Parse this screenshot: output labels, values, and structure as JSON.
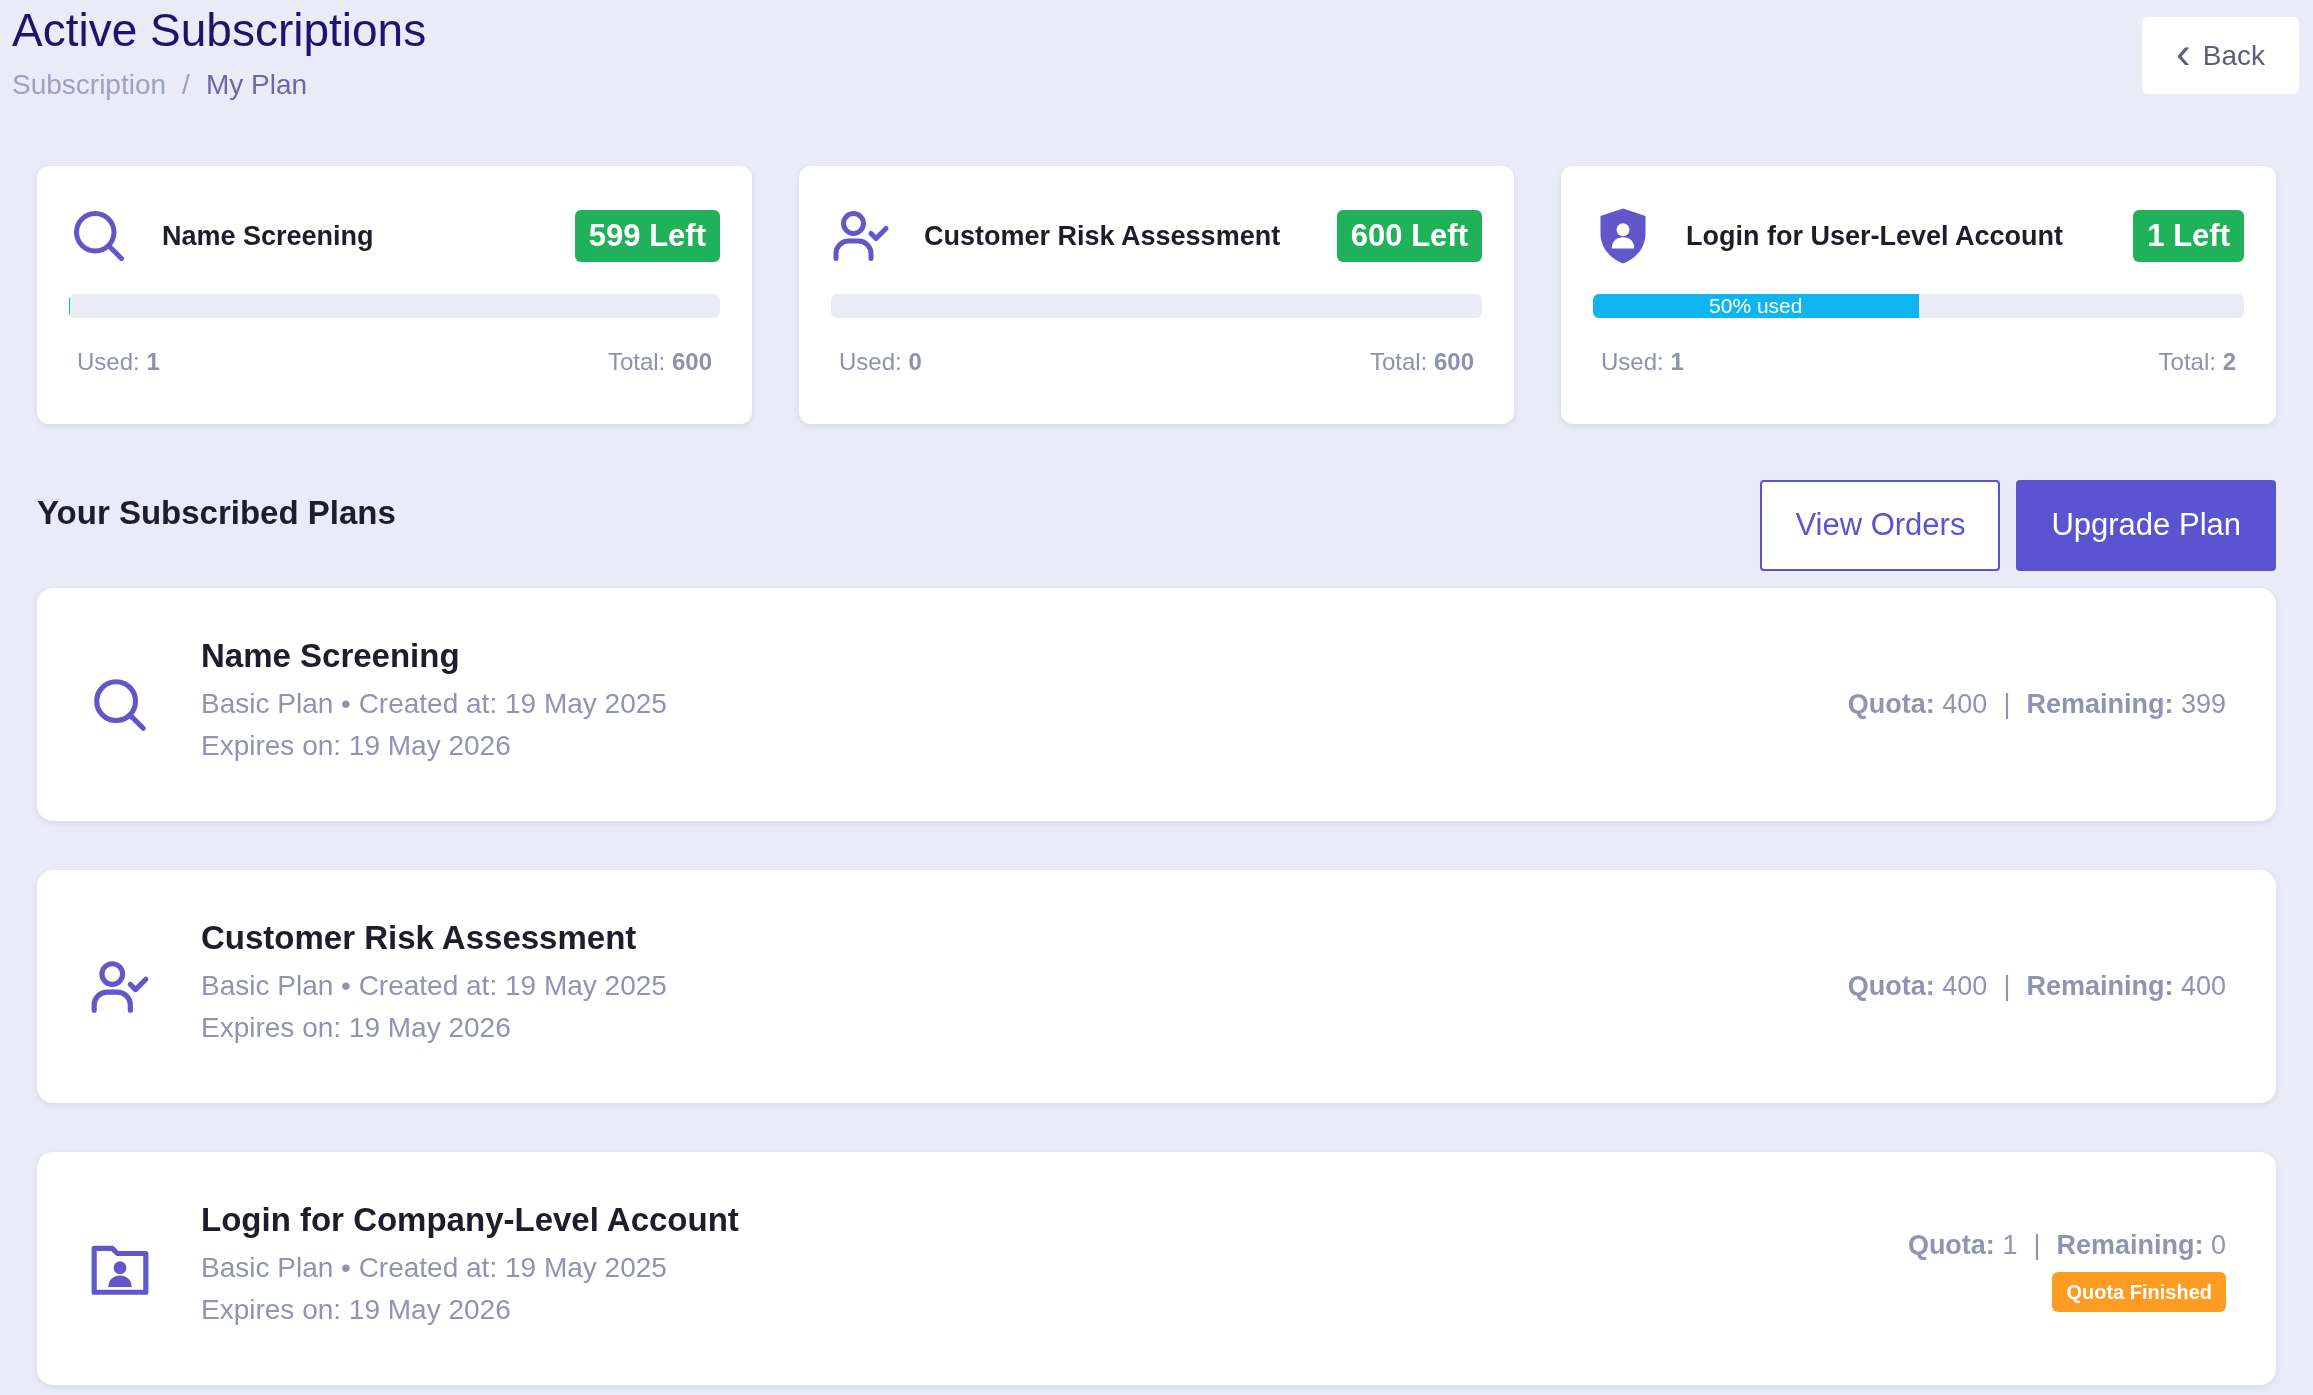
{
  "header": {
    "title": "Active Subscriptions",
    "breadcrumb_separator": "/",
    "breadcrumb": [
      {
        "label": "Subscription",
        "current": false
      },
      {
        "label": "My Plan",
        "current": true
      }
    ],
    "back": {
      "icon": "‹",
      "label": "Back"
    }
  },
  "usage_cards": [
    {
      "kind": "search",
      "title": "Name Screening",
      "badge": "599 Left",
      "level": 0.0017,
      "used_label": "Used:",
      "used": "1",
      "total_label": "Total:",
      "total": "600"
    },
    {
      "kind": "user-check",
      "title": "Customer Risk Assessment",
      "badge": "600 Left",
      "level": 0,
      "used_label": "Used:",
      "used": "0",
      "total_label": "Total:",
      "total": "600"
    },
    {
      "kind": "shield-user",
      "title": "Login for User-Level Account",
      "badge": "1 Left",
      "level": 0.5,
      "bar_label": "50% used",
      "used_label": "Used:",
      "used": "1",
      "total_label": "Total:",
      "total": "2"
    }
  ],
  "section": {
    "title": "Your Subscribed Plans",
    "buttons": [
      {
        "kind": "outline",
        "label": "View Orders"
      },
      {
        "kind": "solid",
        "label": "Upgrade Plan"
      }
    ]
  },
  "plans": [
    {
      "kind": "search",
      "title": "Name Screening",
      "meta": "Basic Plan • Created at: 19 May 2025",
      "expires": "Expires on: 19 May 2026",
      "quota_label": "Quota:",
      "quota": "400",
      "separator": "|",
      "remaining_label": "Remaining:",
      "remaining": "399"
    },
    {
      "kind": "user-check",
      "title": "Customer Risk Assessment",
      "meta": "Basic Plan • Created at: 19 May 2025",
      "expires": "Expires on: 19 May 2026",
      "quota_label": "Quota:",
      "quota": "400",
      "separator": "|",
      "remaining_label": "Remaining:",
      "remaining": "400"
    },
    {
      "kind": "folder-user",
      "title": "Login for Company-Level Account",
      "meta": "Basic Plan • Created at: 19 May 2025",
      "expires": "Expires on: 19 May 2026",
      "quota_label": "Quota:",
      "quota": "1",
      "separator": "|",
      "remaining_label": "Remaining:",
      "remaining": "0",
      "status": "Quota Finished"
    }
  ]
}
